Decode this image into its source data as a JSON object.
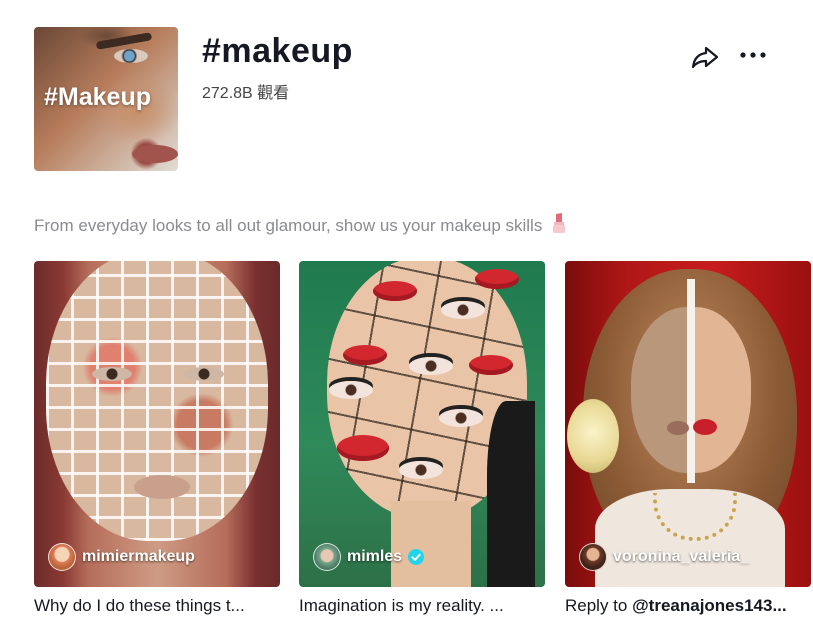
{
  "header": {
    "cover_text": "#Makeup",
    "title": "#makeup",
    "views": "272.8B 觀看"
  },
  "description": "From everyday looks to all out glamour, show us your makeup skills",
  "videos": [
    {
      "author": "mimiermakeup",
      "verified": false,
      "caption": "Why do I do these things t..."
    },
    {
      "author": "mimles",
      "verified": true,
      "caption": "Imagination is my reality. ..."
    },
    {
      "author": "voronina_valeria_",
      "verified": false,
      "caption_prefix": "Reply to ",
      "caption_mention": "@treanajones143..."
    }
  ],
  "icons": {
    "share": "share-arrow-icon",
    "more": "more-dots-icon",
    "lipstick": "lipstick-emoji-icon",
    "verified": "verified-badge-icon"
  },
  "colors": {
    "verified": "#20d5ec",
    "description_text": "#8a8b91",
    "title_text": "#161823"
  }
}
